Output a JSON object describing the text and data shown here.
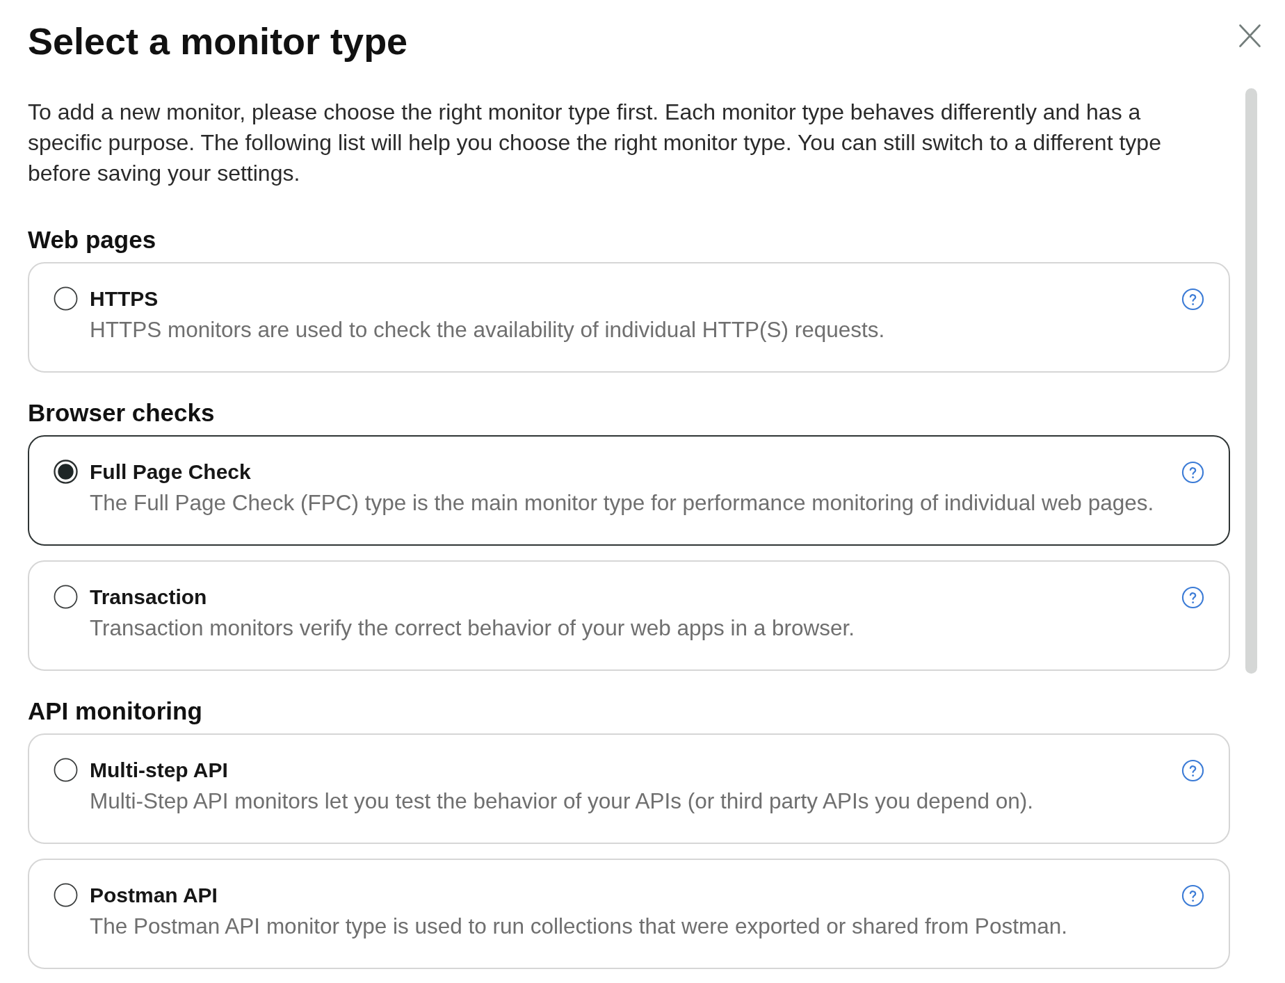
{
  "dialog": {
    "title": "Select a monitor type",
    "description": "To add a new monitor, please choose the right monitor type first. Each monitor type behaves differently and has a specific purpose. The following list will help you choose the right monitor type. You can still switch to a different type before saving your settings.",
    "sections": [
      {
        "heading": "Web pages",
        "options": [
          {
            "label": "HTTPS",
            "description": "HTTPS monitors are used to check the availability of individual HTTP(S) requests.",
            "selected": false
          }
        ]
      },
      {
        "heading": "Browser checks",
        "options": [
          {
            "label": "Full Page Check",
            "description": "The Full Page Check (FPC) type is the main monitor type for performance monitoring of individual web pages.",
            "selected": true
          },
          {
            "label": "Transaction",
            "description": "Transaction monitors verify the correct behavior of your web apps in a browser.",
            "selected": false
          }
        ]
      },
      {
        "heading": "API monitoring",
        "options": [
          {
            "label": "Multi-step API",
            "description": "Multi-Step API monitors let you test the behavior of your APIs (or third party APIs you depend on).",
            "selected": false
          },
          {
            "label": "Postman API",
            "description": "The Postman API monitor type is used to run collections that were exported or shared from Postman.",
            "selected": false
          }
        ]
      }
    ]
  }
}
